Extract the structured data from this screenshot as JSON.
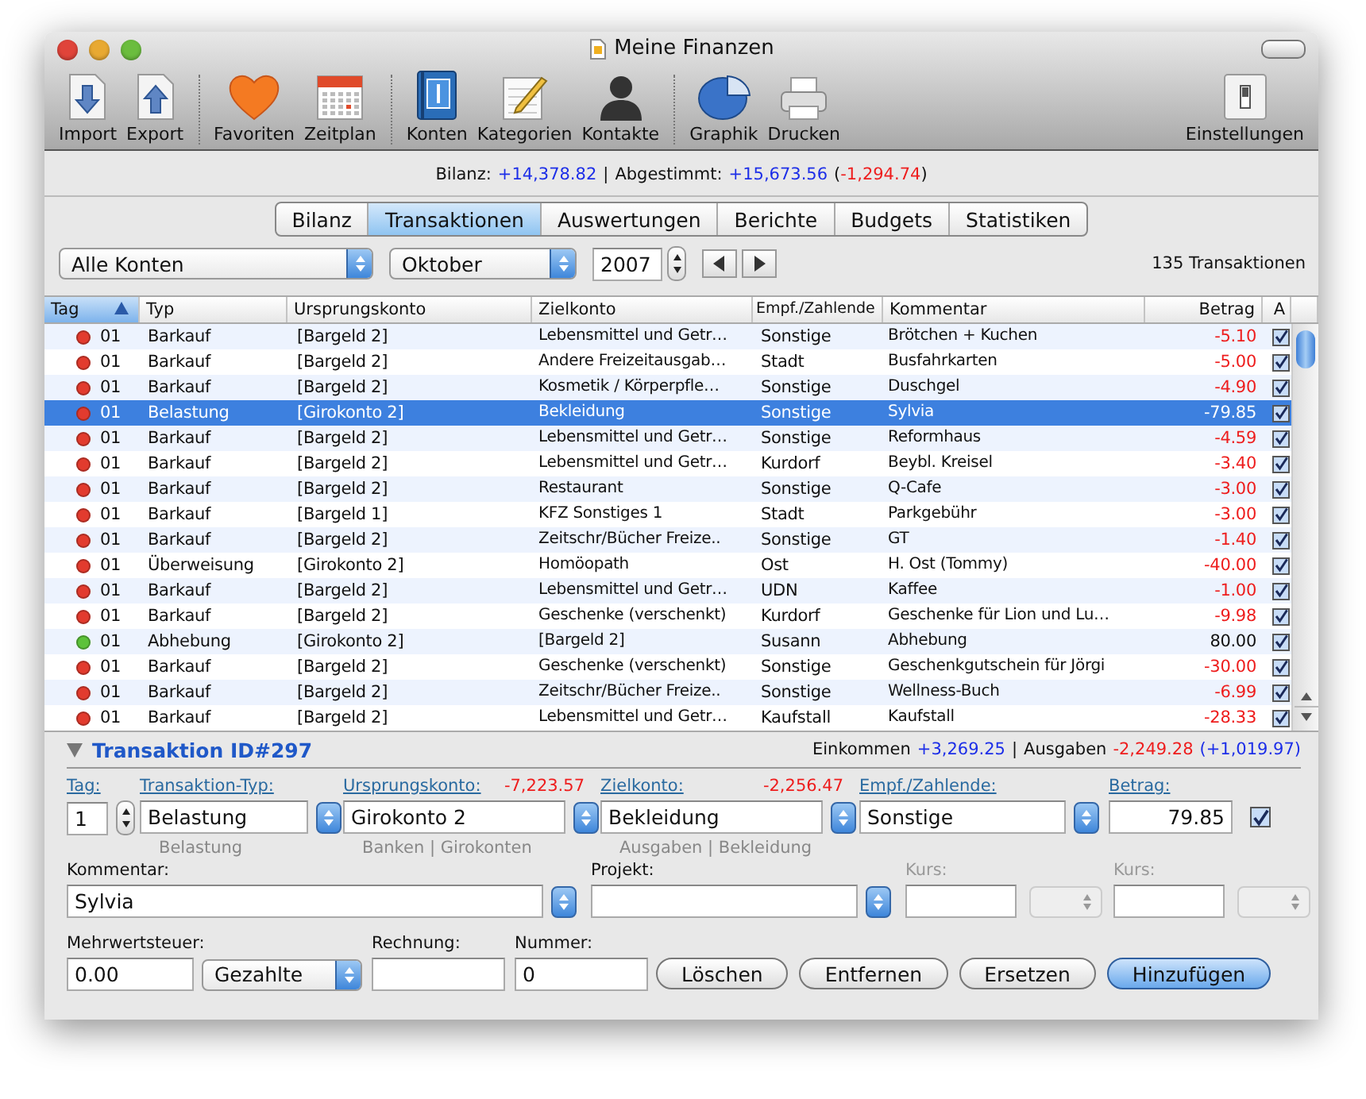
{
  "window": {
    "title": "Meine Finanzen"
  },
  "toolbar": {
    "groups": [
      {
        "items": [
          {
            "label": "Import",
            "kind": "import"
          },
          {
            "label": "Export",
            "kind": "export"
          }
        ]
      },
      {
        "items": [
          {
            "label": "Favoriten",
            "kind": "heart"
          },
          {
            "label": "Zeitplan",
            "kind": "calendar"
          }
        ]
      },
      {
        "items": [
          {
            "label": "Konten",
            "kind": "book"
          },
          {
            "label": "Kategorien",
            "kind": "notepad"
          },
          {
            "label": "Kontakte",
            "kind": "person"
          }
        ]
      },
      {
        "items": [
          {
            "label": "Graphik",
            "kind": "pie"
          },
          {
            "label": "Drucken",
            "kind": "printer"
          }
        ]
      }
    ],
    "settings": {
      "label": "Einstellungen",
      "kind": "switch"
    }
  },
  "summary": {
    "parts": [
      {
        "text": "Bilanz:",
        "kind": "label"
      },
      {
        "text": "+14,378.82",
        "kind": "positive"
      },
      {
        "text": "|",
        "kind": "label"
      },
      {
        "text": "Abgestimmt:",
        "kind": "label"
      },
      {
        "text": "+15,673.56",
        "kind": "positive"
      },
      {
        "text": "(",
        "kind": "open"
      },
      {
        "text": "-1,294.74",
        "kind": "negative"
      },
      {
        "text": ")",
        "kind": "close"
      }
    ]
  },
  "tabs": [
    {
      "label": "Bilanz",
      "selected": false
    },
    {
      "label": "Transaktionen",
      "selected": true
    },
    {
      "label": "Auswertungen",
      "selected": false
    },
    {
      "label": "Berichte",
      "selected": false
    },
    {
      "label": "Budgets",
      "selected": false
    },
    {
      "label": "Statistiken",
      "selected": false
    }
  ],
  "filters": {
    "account": "Alle Konten",
    "month": "Oktober",
    "year": "2007",
    "count": "135 Transaktionen"
  },
  "table": {
    "columns": [
      {
        "label": "Tag",
        "sorted": true
      },
      {
        "label": "Typ",
        "sorted": false
      },
      {
        "label": "Ursprungskonto",
        "sorted": false
      },
      {
        "label": "Zielkonto",
        "sorted": false
      },
      {
        "label": "Empf./Zahlende",
        "sorted": false
      },
      {
        "label": "Kommentar",
        "sorted": false
      },
      {
        "label": "Betrag",
        "sorted": false
      },
      {
        "label": "A",
        "sorted": false
      }
    ],
    "rows": [
      {
        "color": "#e23b2e",
        "tag": "01",
        "typ": "Barkauf",
        "ursprung": "[Bargeld 2]",
        "ziel": "Lebensmittel und Getr…",
        "empf": "Sonstige",
        "kommentar": "Brötchen + Kuchen",
        "betrag": "-5.10",
        "negative": true,
        "checked": true,
        "selected": false
      },
      {
        "color": "#e23b2e",
        "tag": "01",
        "typ": "Barkauf",
        "ursprung": "[Bargeld 2]",
        "ziel": "Andere Freizeitausgab…",
        "empf": "Stadt",
        "kommentar": "Busfahrkarten",
        "betrag": "-5.00",
        "negative": true,
        "checked": true,
        "selected": false
      },
      {
        "color": "#e23b2e",
        "tag": "01",
        "typ": "Barkauf",
        "ursprung": "[Bargeld 2]",
        "ziel": "Kosmetik / Körperpfle…",
        "empf": "Sonstige",
        "kommentar": "Duschgel",
        "betrag": "-4.90",
        "negative": true,
        "checked": true,
        "selected": false
      },
      {
        "color": "#e23b2e",
        "tag": "01",
        "typ": "Belastung",
        "ursprung": "[Girokonto 2]",
        "ziel": "Bekleidung",
        "empf": "Sonstige",
        "kommentar": "Sylvia",
        "betrag": "-79.85",
        "negative": true,
        "checked": true,
        "selected": true
      },
      {
        "color": "#e23b2e",
        "tag": "01",
        "typ": "Barkauf",
        "ursprung": "[Bargeld 2]",
        "ziel": "Lebensmittel und Getr…",
        "empf": "Sonstige",
        "kommentar": "Reformhaus",
        "betrag": "-4.59",
        "negative": true,
        "checked": true,
        "selected": false
      },
      {
        "color": "#e23b2e",
        "tag": "01",
        "typ": "Barkauf",
        "ursprung": "[Bargeld 2]",
        "ziel": "Lebensmittel und Getr…",
        "empf": "Kurdorf",
        "kommentar": "Beybl. Kreisel",
        "betrag": "-3.40",
        "negative": true,
        "checked": true,
        "selected": false
      },
      {
        "color": "#e23b2e",
        "tag": "01",
        "typ": "Barkauf",
        "ursprung": "[Bargeld 2]",
        "ziel": "Restaurant",
        "empf": "Sonstige",
        "kommentar": "Q-Cafe",
        "betrag": "-3.00",
        "negative": true,
        "checked": true,
        "selected": false
      },
      {
        "color": "#e23b2e",
        "tag": "01",
        "typ": "Barkauf",
        "ursprung": "[Bargeld 1]",
        "ziel": "KFZ Sonstiges 1",
        "empf": "Stadt",
        "kommentar": "Parkgebühr",
        "betrag": "-3.00",
        "negative": true,
        "checked": true,
        "selected": false
      },
      {
        "color": "#e23b2e",
        "tag": "01",
        "typ": "Barkauf",
        "ursprung": "[Bargeld 2]",
        "ziel": "Zeitschr/Bücher  Freize..",
        "empf": "Sonstige",
        "kommentar": "GT",
        "betrag": "-1.40",
        "negative": true,
        "checked": true,
        "selected": false
      },
      {
        "color": "#e23b2e",
        "tag": "01",
        "typ": "Überweisung",
        "ursprung": "[Girokonto 2]",
        "ziel": "Homöopath",
        "empf": "Ost",
        "kommentar": "H. Ost (Tommy)",
        "betrag": "-40.00",
        "negative": true,
        "checked": true,
        "selected": false
      },
      {
        "color": "#e23b2e",
        "tag": "01",
        "typ": "Barkauf",
        "ursprung": "[Bargeld 2]",
        "ziel": "Lebensmittel und Getr…",
        "empf": "UDN",
        "kommentar": "Kaffee",
        "betrag": "-1.00",
        "negative": true,
        "checked": true,
        "selected": false
      },
      {
        "color": "#e23b2e",
        "tag": "01",
        "typ": "Barkauf",
        "ursprung": "[Bargeld 2]",
        "ziel": "Geschenke (verschenkt)",
        "empf": "Kurdorf",
        "kommentar": "Geschenke für Lion und Lu…",
        "betrag": "-9.98",
        "negative": true,
        "checked": true,
        "selected": false
      },
      {
        "color": "#5cc23a",
        "tag": "01",
        "typ": "Abhebung",
        "ursprung": "[Girokonto 2]",
        "ziel": "[Bargeld 2]",
        "empf": "Susann",
        "kommentar": "Abhebung",
        "betrag": "80.00",
        "negative": false,
        "checked": true,
        "selected": false
      },
      {
        "color": "#e23b2e",
        "tag": "01",
        "typ": "Barkauf",
        "ursprung": "[Bargeld 2]",
        "ziel": "Geschenke (verschenkt)",
        "empf": "Sonstige",
        "kommentar": "Geschenkgutschein für Jörgi",
        "betrag": "-30.00",
        "negative": true,
        "checked": true,
        "selected": false
      },
      {
        "color": "#e23b2e",
        "tag": "01",
        "typ": "Barkauf",
        "ursprung": "[Bargeld 2]",
        "ziel": "Zeitschr/Bücher  Freize..",
        "empf": "Sonstige",
        "kommentar": "Wellness-Buch",
        "betrag": "-6.99",
        "negative": true,
        "checked": true,
        "selected": false
      },
      {
        "color": "#e23b2e",
        "tag": "01",
        "typ": "Barkauf",
        "ursprung": "[Bargeld 2]",
        "ziel": "Lebensmittel und Getr…",
        "empf": "Kaufstall",
        "kommentar": "Kaufstall",
        "betrag": "-28.33",
        "negative": true,
        "checked": true,
        "selected": false
      }
    ]
  },
  "detail": {
    "title": "Transaktion ID#297",
    "expanded": true,
    "totals": [
      {
        "text": "Einkommen",
        "kind": "label"
      },
      {
        "text": "+3,269.25",
        "kind": "positive"
      },
      {
        "text": "|",
        "kind": "label"
      },
      {
        "text": "Ausgaben",
        "kind": "label"
      },
      {
        "text": "-2,249.28",
        "kind": "negative"
      },
      {
        "text": "(+1,019.97)",
        "kind": "positive"
      }
    ],
    "tag": {
      "label": "Tag:",
      "value": "1"
    },
    "typ": {
      "label": "Transaktion-Typ:",
      "value": "Belastung",
      "hint": "Belastung"
    },
    "ursprung": {
      "label": "Ursprungskonto:",
      "balance": "-7,223.57",
      "value": "Girokonto 2",
      "hint": "Banken | Girokonten"
    },
    "ziel": {
      "label": "Zielkonto:",
      "balance": "-2,256.47",
      "value": "Bekleidung",
      "hint": "Ausgaben | Bekleidung"
    },
    "empf": {
      "label": "Empf./Zahlende:",
      "value": "Sonstige"
    },
    "betrag": {
      "label": "Betrag:",
      "value": "79.85",
      "checked": true
    },
    "kommentar": {
      "label": "Kommentar:",
      "value": "Sylvia"
    },
    "projekt": {
      "label": "Projekt:"
    },
    "kurs": [
      {
        "label": "Kurs:",
        "disabled": true
      },
      {
        "label": "Kurs:",
        "disabled": true
      }
    ],
    "mwst": {
      "label": "Mehrwertsteuer:",
      "value": "0.00",
      "mode": "Gezahlte"
    },
    "rechnung": {
      "label": "Rechnung:"
    },
    "nummer": {
      "label": "Nummer:",
      "value": "0"
    },
    "buttons": [
      {
        "label": "Löschen",
        "default": false
      },
      {
        "label": "Entfernen",
        "default": false
      },
      {
        "label": "Ersetzen",
        "default": false
      },
      {
        "label": "Hinzufügen",
        "default": true
      }
    ]
  }
}
